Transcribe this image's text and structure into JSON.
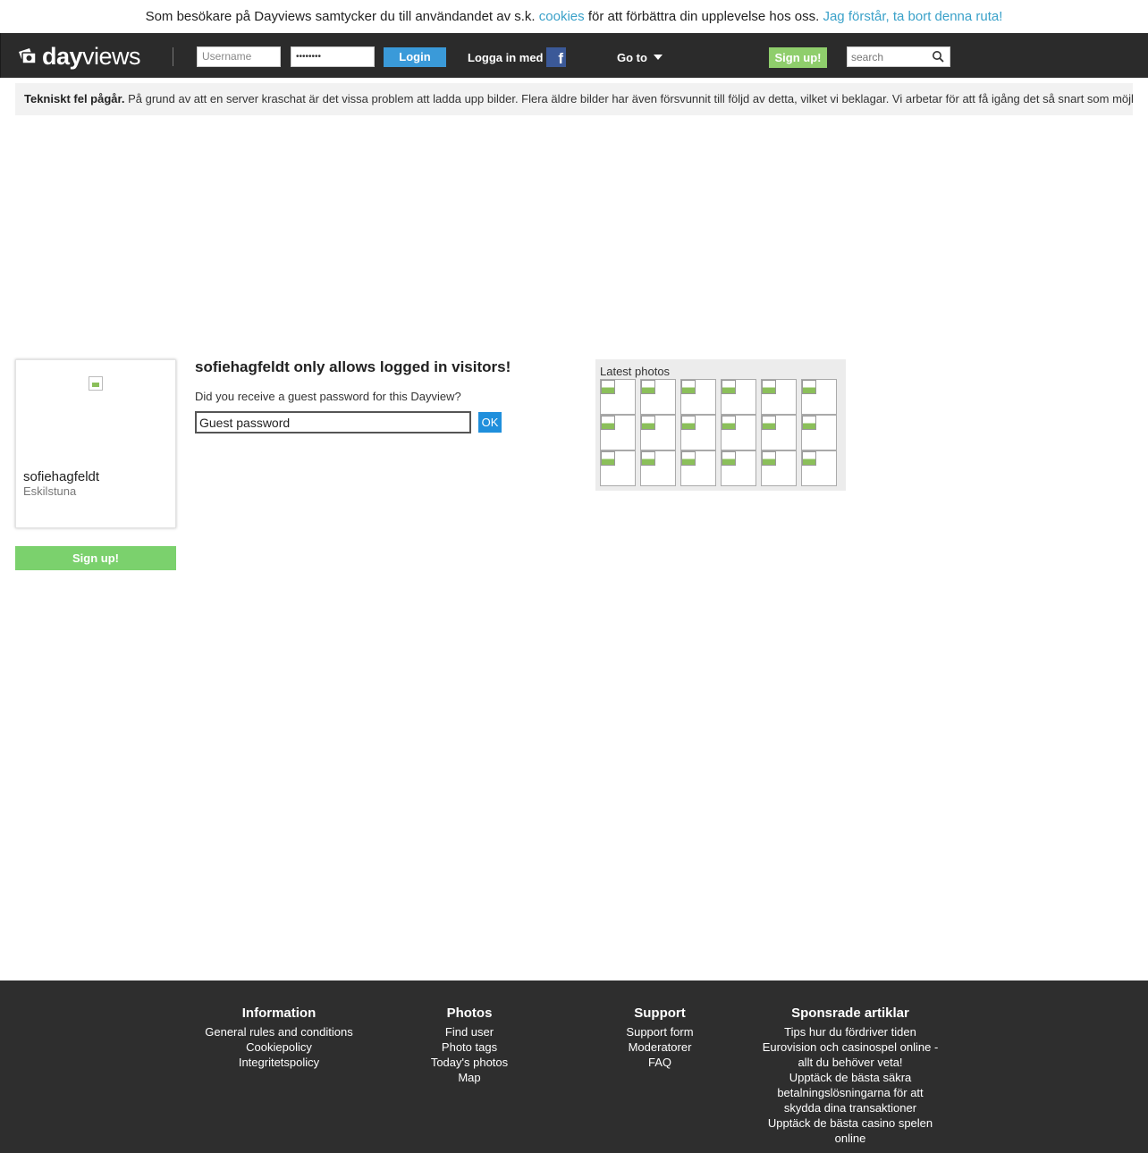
{
  "cookie_bar": {
    "text_before": "Som besökare på Dayviews samtycker du till användandet av s.k.",
    "cookies_link": "cookies",
    "text_after": "för att förbättra din upplevelse hos oss.",
    "dismiss_link": "Jag förstår, ta bort denna ruta!"
  },
  "nav": {
    "logo_bold": "day",
    "logo_rest": "views",
    "username_placeholder": "Username",
    "password_value": "••••••••",
    "login_label": "Login",
    "fb_login_text": "Logga in med",
    "goto_label": "Go to",
    "signup_label": "Sign up!",
    "search_placeholder": "search"
  },
  "notice": {
    "title": "Tekniskt fel pågår.",
    "text": "På grund av att en server kraschat är det vissa problem att ladda upp bilder. Flera äldre bilder har även försvunnit till följd av detta, vilket vi beklagar. Vi arbetar för att få igång det så snart som möjligt."
  },
  "profile": {
    "name": "sofiehagfeldt",
    "city": "Eskilstuna",
    "signup_label": "Sign up!"
  },
  "guest": {
    "title": "sofiehagfeldt only allows logged in visitors!",
    "question": "Did you receive a guest password for this Dayview?",
    "input_value": "Guest password",
    "ok_label": "OK"
  },
  "latest_photos": {
    "title": "Latest photos",
    "count": 18
  },
  "footer": {
    "columns": [
      {
        "title": "Information",
        "links": [
          "General rules and conditions",
          "Cookiepolicy",
          "Integritetspolicy"
        ]
      },
      {
        "title": "Photos",
        "links": [
          "Find user",
          "Photo tags",
          "Today's photos",
          "Map"
        ]
      },
      {
        "title": "Support",
        "links": [
          "Support form",
          "Moderatorer",
          "FAQ"
        ]
      },
      {
        "title": "Sponsrade artiklar",
        "links": [
          "Tips hur du fördriver tiden Eurovision och casinospel online - allt du behöver veta!",
          "Upptäck de bästa säkra betalningslösningarna för att skydda dina transaktioner",
          "Upptäck de bästa casino spelen online"
        ]
      }
    ]
  }
}
